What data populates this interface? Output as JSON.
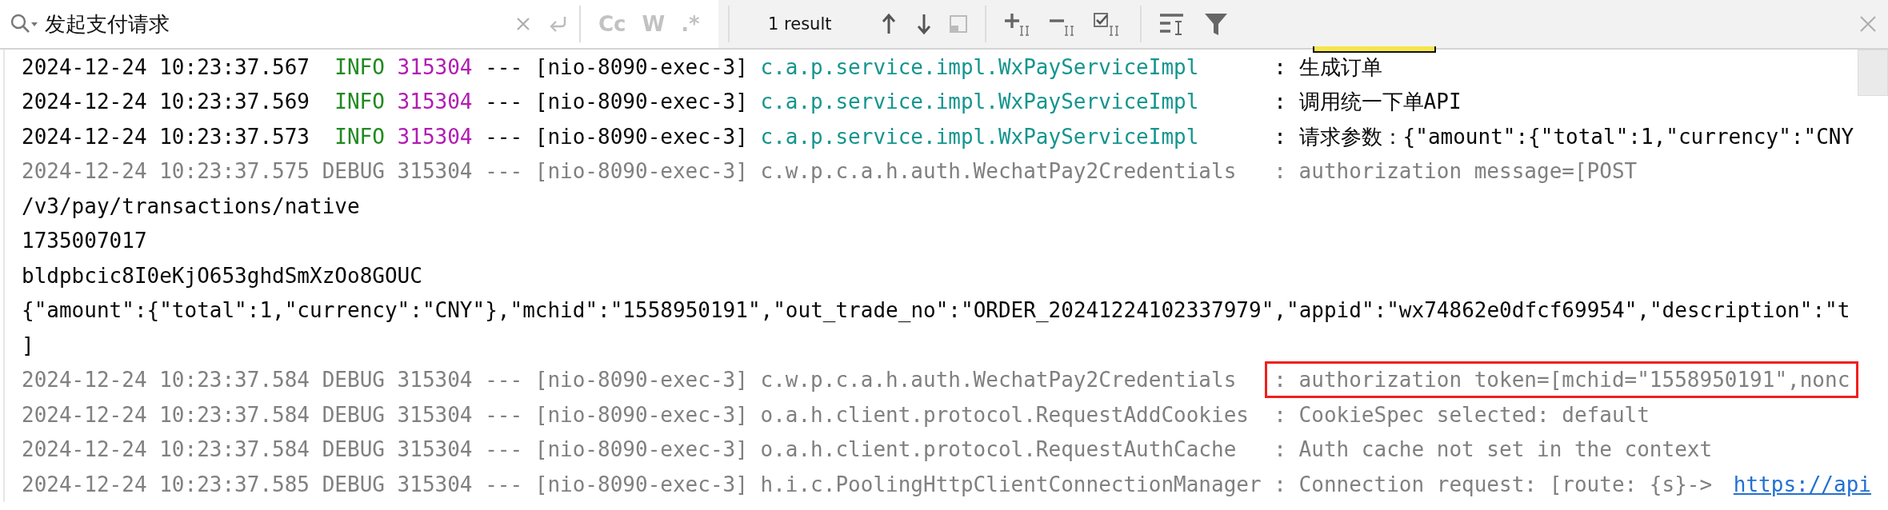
{
  "search": {
    "query": "发起支付请求",
    "options": [
      {
        "label": "Cc",
        "selected": false
      },
      {
        "label": "W",
        "selected": false
      },
      {
        "label": ".*",
        "selected": false
      }
    ],
    "result_count": "1 result"
  },
  "log_lines": [
    {
      "kind": "info",
      "timestamp": "2024-12-24 10:23:37.567",
      "level": "INFO",
      "pid": "315304",
      "separator": "---",
      "thread": "[nio-8090-exec-3]",
      "logger": "c.a.p.service.impl.WxPayServiceImpl",
      "message": ": 生成订单",
      "highlighted": false
    },
    {
      "kind": "info",
      "timestamp": "2024-12-24 10:23:37.569",
      "level": "INFO",
      "pid": "315304",
      "separator": "---",
      "thread": "[nio-8090-exec-3]",
      "logger": "c.a.p.service.impl.WxPayServiceImpl",
      "message": ": 调用统一下单API",
      "highlighted": false
    },
    {
      "kind": "info",
      "timestamp": "2024-12-24 10:23:37.573",
      "level": "INFO",
      "pid": "315304",
      "separator": "---",
      "thread": "[nio-8090-exec-3]",
      "logger": "c.a.p.service.impl.WxPayServiceImpl",
      "message": ": 请求参数：{\"amount\":{\"total\":1,\"currency\":\"CNY",
      "highlighted": false
    },
    {
      "kind": "debug",
      "timestamp": "2024-12-24 10:23:37.575",
      "level": "DEBUG",
      "pid": "315304",
      "separator": "---",
      "thread": "[nio-8090-exec-3]",
      "logger": "c.w.p.c.a.h.auth.WechatPay2Credentials",
      "message": ": authorization message=[POST",
      "highlighted": false
    },
    {
      "kind": "text",
      "text": "/v3/pay/transactions/native"
    },
    {
      "kind": "text",
      "text": "1735007017"
    },
    {
      "kind": "text",
      "text": "bldpbcic8I0eKjO653ghdSmXzOo8GOUC"
    },
    {
      "kind": "text",
      "text": "{\"amount\":{\"total\":1,\"currency\":\"CNY\"},\"mchid\":\"1558950191\",\"out_trade_no\":\"ORDER_20241224102337979\",\"appid\":\"wx74862e0dfcf69954\",\"description\":\"t"
    },
    {
      "kind": "text",
      "text": "]"
    },
    {
      "kind": "debug",
      "timestamp": "2024-12-24 10:23:37.584",
      "level": "DEBUG",
      "pid": "315304",
      "separator": "---",
      "thread": "[nio-8090-exec-3]",
      "logger": "c.w.p.c.a.h.auth.WechatPay2Credentials",
      "message": ": authorization token=[mchid=\"1558950191\",nonc",
      "highlighted": true
    },
    {
      "kind": "debug",
      "timestamp": "2024-12-24 10:23:37.584",
      "level": "DEBUG",
      "pid": "315304",
      "separator": "---",
      "thread": "[nio-8090-exec-3]",
      "logger": "o.a.h.client.protocol.RequestAddCookies",
      "message": ": CookieSpec selected: default",
      "highlighted": false
    },
    {
      "kind": "debug",
      "timestamp": "2024-12-24 10:23:37.584",
      "level": "DEBUG",
      "pid": "315304",
      "separator": "---",
      "thread": "[nio-8090-exec-3]",
      "logger": "o.a.h.client.protocol.RequestAuthCache",
      "message": ": Auth cache not set in the context",
      "highlighted": false
    },
    {
      "kind": "debug",
      "timestamp": "2024-12-24 10:23:37.585",
      "level": "DEBUG",
      "pid": "315304",
      "separator": "---",
      "thread": "[nio-8090-exec-3]",
      "logger": "h.i.c.PoolingHttpClientConnectionManager",
      "message": ": Connection request: [route: {s}->",
      "link": "https://api",
      "highlighted": false
    }
  ]
}
